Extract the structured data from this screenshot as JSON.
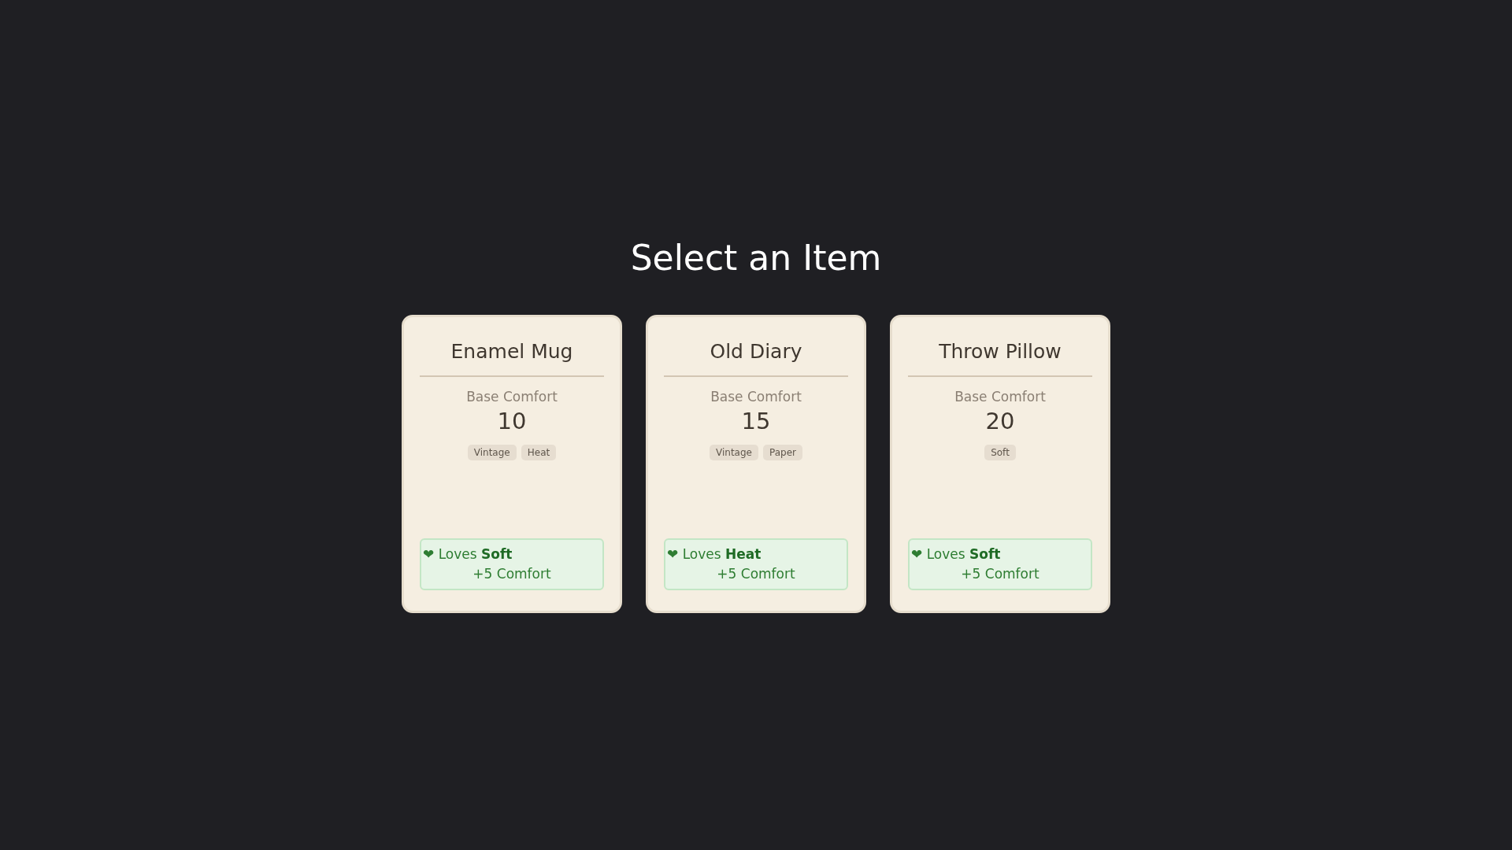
{
  "heading": "Select an Item",
  "cards": [
    {
      "name": "Enamel Mug",
      "stat_label": "Base Comfort",
      "stat_value": "10",
      "tags": [
        "Vintage",
        "Heat"
      ],
      "bonus": {
        "text": "❤ Loves **Soft**",
        "effect": "+5 Comfort"
      }
    },
    {
      "name": "Old Diary",
      "stat_label": "Base Comfort",
      "stat_value": "15",
      "tags": [
        "Vintage",
        "Paper"
      ],
      "bonus": {
        "text": "❤ Loves **Heat**",
        "effect": "+5 Comfort"
      }
    },
    {
      "name": "Throw Pillow",
      "stat_label": "Base Comfort",
      "stat_value": "20",
      "tags": [
        "Soft"
      ],
      "bonus": {
        "text": "❤ Loves **Soft**",
        "effect": "+5 Comfort"
      }
    }
  ]
}
